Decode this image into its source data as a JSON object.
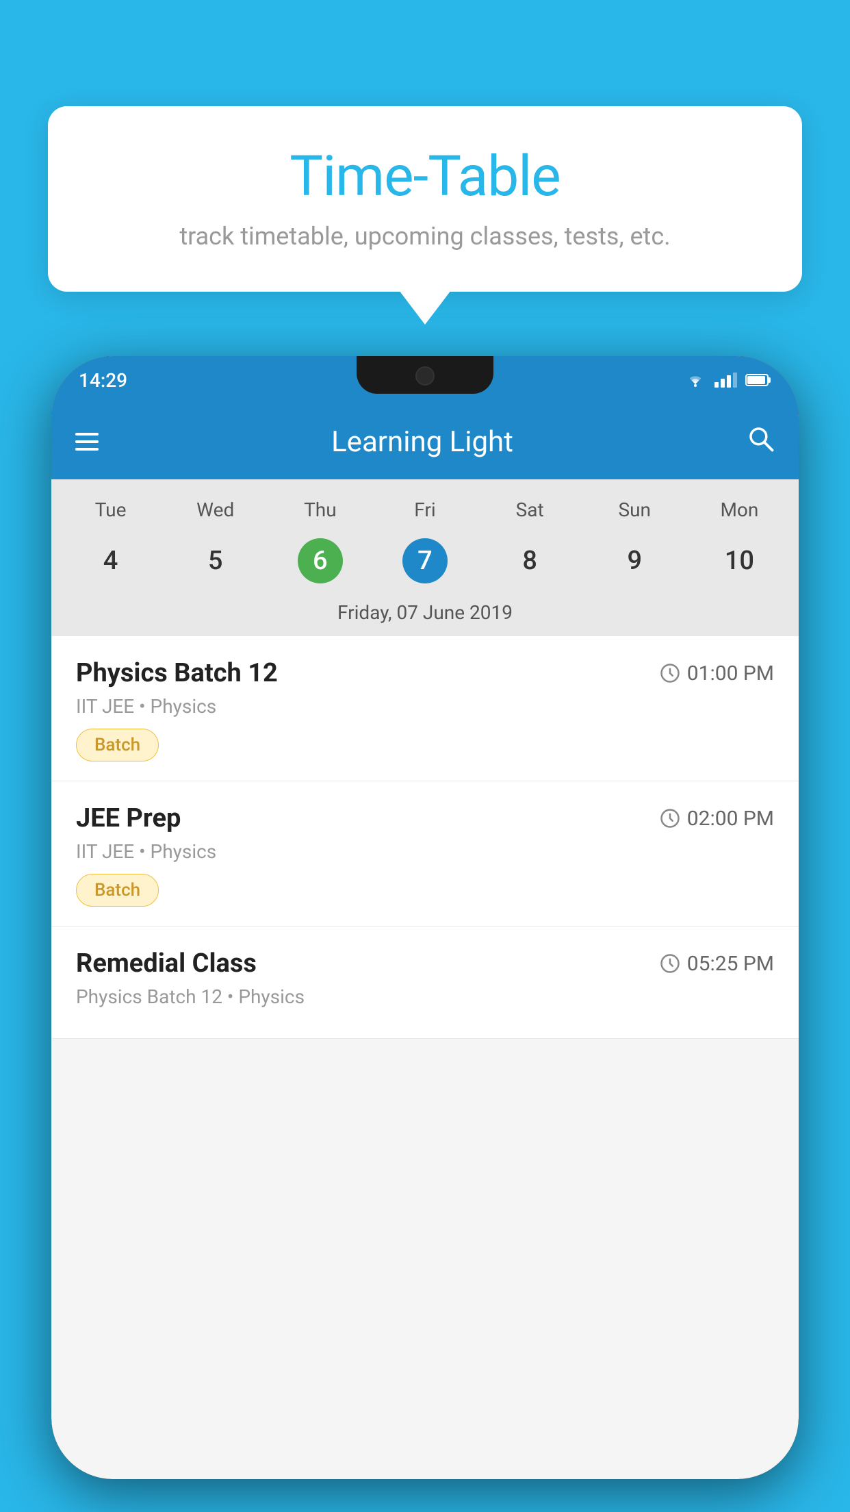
{
  "background_color": "#29b6e8",
  "speech_bubble": {
    "title": "Time-Table",
    "subtitle": "track timetable, upcoming classes, tests, etc."
  },
  "phone": {
    "status_bar": {
      "time": "14:29"
    },
    "app_bar": {
      "title": "Learning Light"
    },
    "calendar": {
      "days": [
        {
          "label": "Tue",
          "number": "4"
        },
        {
          "label": "Wed",
          "number": "5"
        },
        {
          "label": "Thu",
          "number": "6",
          "state": "today"
        },
        {
          "label": "Fri",
          "number": "7",
          "state": "selected"
        },
        {
          "label": "Sat",
          "number": "8"
        },
        {
          "label": "Sun",
          "number": "9"
        },
        {
          "label": "Mon",
          "number": "10"
        }
      ],
      "selected_date_label": "Friday, 07 June 2019"
    },
    "schedule": [
      {
        "title": "Physics Batch 12",
        "time": "01:00 PM",
        "subtitle": "IIT JEE • Physics",
        "badge": "Batch"
      },
      {
        "title": "JEE Prep",
        "time": "02:00 PM",
        "subtitle": "IIT JEE • Physics",
        "badge": "Batch"
      },
      {
        "title": "Remedial Class",
        "time": "05:25 PM",
        "subtitle": "Physics Batch 12 • Physics",
        "badge": null
      }
    ]
  }
}
